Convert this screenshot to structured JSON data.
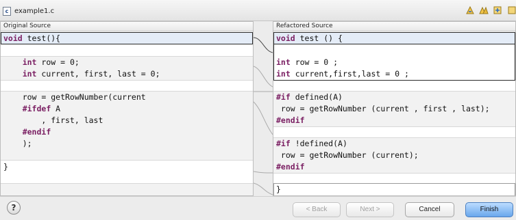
{
  "file_tab": {
    "name": "example1.c",
    "icon": "c-file-icon"
  },
  "toolbar_icons": [
    "copy-left-to-right-icon",
    "copy-right-to-left-icon",
    "next-difference-icon",
    "previous-difference-icon"
  ],
  "left_pane": {
    "title": "Original Source",
    "lines": [
      {
        "parts": [
          {
            "t": "void",
            "kw": true
          },
          {
            "t": " test(){"
          }
        ]
      },
      {
        "parts": []
      },
      {
        "parts": [
          {
            "t": "    "
          },
          {
            "t": "int",
            "kw": true
          },
          {
            "t": " row = 0;"
          }
        ]
      },
      {
        "parts": [
          {
            "t": "    "
          },
          {
            "t": "int",
            "kw": true
          },
          {
            "t": " current, first, last = 0;"
          }
        ]
      },
      {
        "parts": []
      },
      {
        "parts": [
          {
            "t": "    row = getRowNumber(current"
          }
        ]
      },
      {
        "parts": [
          {
            "t": "    "
          },
          {
            "t": "#ifdef",
            "kw": true
          },
          {
            "t": " A"
          }
        ]
      },
      {
        "parts": [
          {
            "t": "        , first, last"
          }
        ]
      },
      {
        "parts": [
          {
            "t": "    "
          },
          {
            "t": "#endif",
            "kw": true
          }
        ]
      },
      {
        "parts": [
          {
            "t": "    );"
          }
        ]
      },
      {
        "parts": []
      },
      {
        "parts": [
          {
            "t": "}"
          }
        ]
      }
    ]
  },
  "right_pane": {
    "title": "Refactored Source",
    "lines": [
      {
        "parts": [
          {
            "t": "void",
            "kw": true
          },
          {
            "t": " test () {"
          }
        ]
      },
      {
        "parts": []
      },
      {
        "parts": [
          {
            "t": "int",
            "kw": true
          },
          {
            "t": " row = 0 ;"
          }
        ]
      },
      {
        "parts": [
          {
            "t": "int",
            "kw": true
          },
          {
            "t": " current,first,last = 0 ;"
          }
        ]
      },
      {
        "parts": []
      },
      {
        "parts": [
          {
            "t": "#if",
            "kw": true
          },
          {
            "t": " defined(A)"
          }
        ]
      },
      {
        "parts": [
          {
            "t": " row = getRowNumber (current , first , last);"
          }
        ]
      },
      {
        "parts": [
          {
            "t": "#endif",
            "kw": true
          }
        ]
      },
      {
        "parts": []
      },
      {
        "parts": [
          {
            "t": "#if",
            "kw": true
          },
          {
            "t": " !defined(A)"
          }
        ]
      },
      {
        "parts": [
          {
            "t": " row = getRowNumber (current);"
          }
        ]
      },
      {
        "parts": [
          {
            "t": "#endif",
            "kw": true
          }
        ]
      },
      {
        "parts": []
      },
      {
        "parts": [
          {
            "t": "}"
          }
        ]
      }
    ]
  },
  "buttons": {
    "help": "?",
    "back": "< Back",
    "next": "Next >",
    "cancel": "Cancel",
    "finish": "Finish"
  }
}
